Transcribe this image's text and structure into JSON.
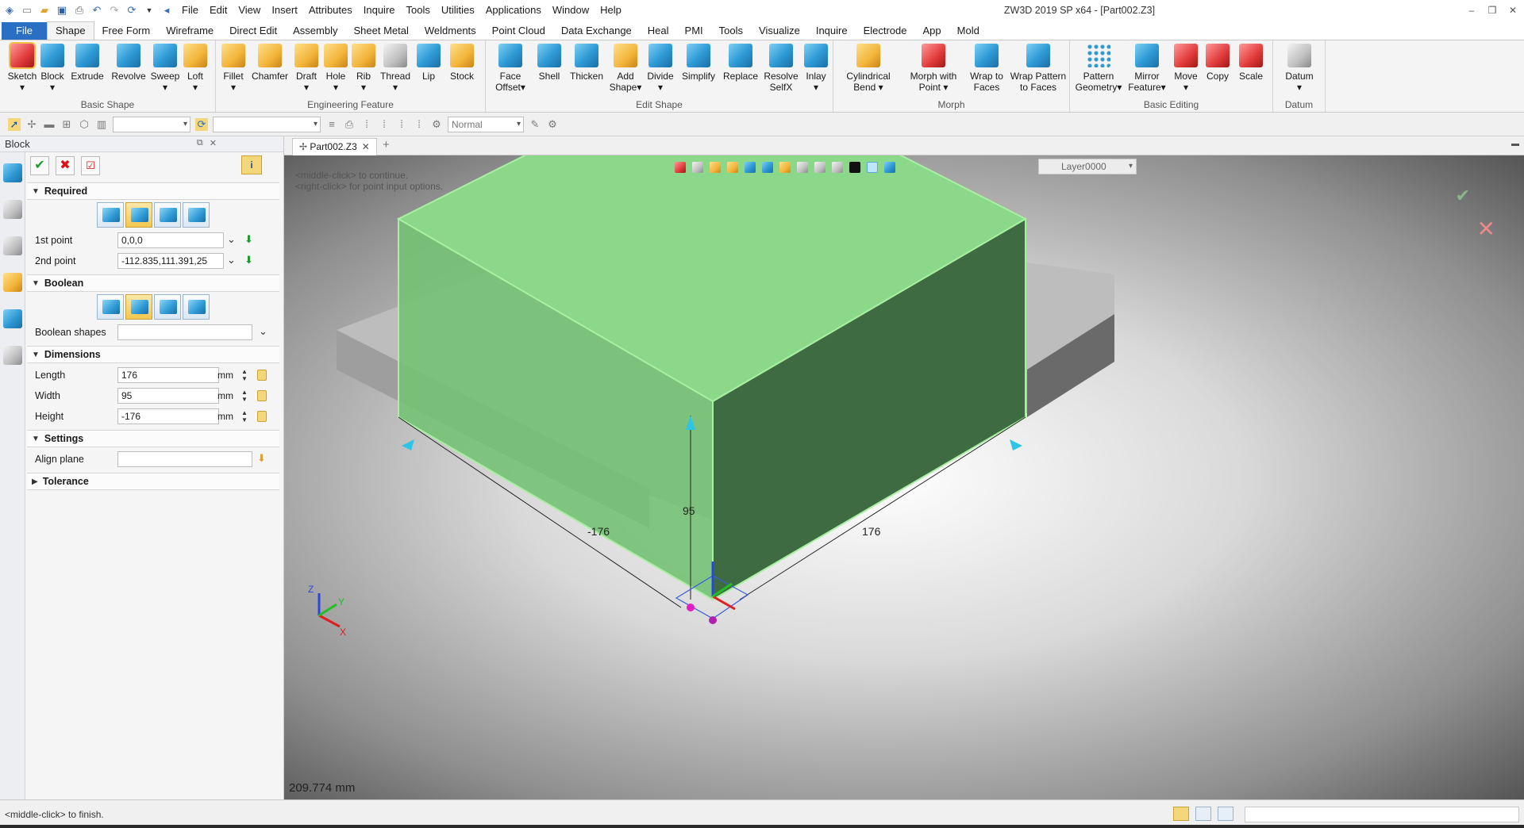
{
  "window": {
    "title": "ZW3D 2019 SP x64 - [Part002.Z3]"
  },
  "menu": [
    "File",
    "Edit",
    "View",
    "Insert",
    "Attributes",
    "Inquire",
    "Tools",
    "Utilities",
    "Applications",
    "Window",
    "Help"
  ],
  "ribbon_tabs": [
    "File",
    "Shape",
    "Free Form",
    "Wireframe",
    "Direct Edit",
    "Assembly",
    "Sheet Metal",
    "Weldments",
    "Point Cloud",
    "Data Exchange",
    "Heal",
    "PMI",
    "Tools",
    "Visualize",
    "Inquire",
    "Electrode",
    "App",
    "Mold"
  ],
  "ribbon": {
    "basic_shape": {
      "label": "Basic Shape",
      "buttons": [
        "Sketch",
        "Block",
        "Extrude",
        "Revolve",
        "Sweep",
        "Loft"
      ]
    },
    "engineering_feature": {
      "label": "Engineering Feature",
      "buttons": [
        "Fillet",
        "Chamfer",
        "Draft",
        "Hole",
        "Rib",
        "Thread",
        "Lip",
        "Stock"
      ]
    },
    "edit_shape": {
      "label": "Edit Shape",
      "buttons": [
        [
          "Face",
          "Offset"
        ],
        [
          "Shell"
        ],
        [
          "Thicken"
        ],
        [
          "Add",
          "Shape"
        ],
        [
          "Divide"
        ],
        [
          "Simplify"
        ],
        [
          "Replace"
        ],
        [
          "Resolve",
          "SelfX"
        ],
        [
          "Inlay"
        ]
      ]
    },
    "morph": {
      "label": "Morph",
      "buttons": [
        [
          "Cylindrical",
          "Bend"
        ],
        [
          "Morph with",
          "Point"
        ],
        [
          "Wrap to",
          "Faces"
        ],
        [
          "Wrap Pattern",
          "to Faces"
        ]
      ]
    },
    "basic_editing": {
      "label": "Basic Editing",
      "buttons": [
        [
          "Pattern",
          "Geometry"
        ],
        [
          "Mirror",
          "Feature"
        ],
        [
          "Move"
        ],
        [
          "Copy"
        ],
        [
          "Scale"
        ]
      ]
    },
    "datum": {
      "label": "Datum",
      "buttons": [
        "Datum"
      ]
    }
  },
  "toolbar2": {
    "filter_combo": "",
    "level_combo": "",
    "style_combo": "Normal"
  },
  "panel": {
    "title": "Block",
    "sections": {
      "required": "Required",
      "boolean": "Boolean",
      "dimensions": "Dimensions",
      "settings": "Settings",
      "tolerance": "Tolerance"
    },
    "fields": {
      "first_point": {
        "label": "1st point",
        "value": "0,0,0"
      },
      "second_point": {
        "label": "2nd point",
        "value": "-112.835,111.391,25"
      },
      "boolean_shapes": {
        "label": "Boolean shapes",
        "value": ""
      },
      "length": {
        "label": "Length",
        "value": "176",
        "unit": "mm"
      },
      "width": {
        "label": "Width",
        "value": "95",
        "unit": "mm"
      },
      "height": {
        "label": "Height",
        "value": "-176",
        "unit": "mm"
      },
      "align_plane": {
        "label": "Align plane",
        "value": ""
      }
    }
  },
  "doc_tab": {
    "label": "Part002.Z3"
  },
  "viewport": {
    "hint1": "<middle-click> to continue.",
    "hint2": "<right-click> for point input options.",
    "layer": "Layer0000",
    "dim_left": "-176",
    "dim_height": "95",
    "dim_right": "176",
    "distance": "209.774 mm",
    "axis_z": "Z",
    "axis_x": "X",
    "axis_y": "Y",
    "colors": {
      "preview_fill": "#8bd88b",
      "preview_edge": "#a8f0a0",
      "base_block": "#bdbdbd"
    }
  },
  "status": {
    "text": "<middle-click> to finish."
  }
}
